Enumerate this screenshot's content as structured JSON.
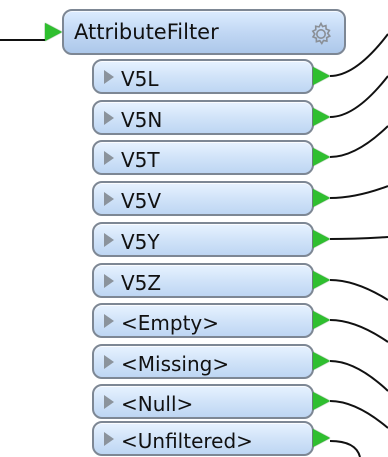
{
  "transformer": {
    "name": "AttributeFilter",
    "settings_icon": "gear-icon"
  },
  "ports": [
    {
      "label": "V5L"
    },
    {
      "label": "V5N"
    },
    {
      "label": "V5T"
    },
    {
      "label": "V5V"
    },
    {
      "label": "V5Y"
    },
    {
      "label": "V5Z"
    },
    {
      "label": "<Empty>"
    },
    {
      "label": "<Missing>"
    },
    {
      "label": "<Null>"
    },
    {
      "label": "<Unfiltered>"
    }
  ],
  "colors": {
    "port_green": "#2fbf2f",
    "connection_line": "#111111",
    "node_blue": "#bfd6f3"
  }
}
